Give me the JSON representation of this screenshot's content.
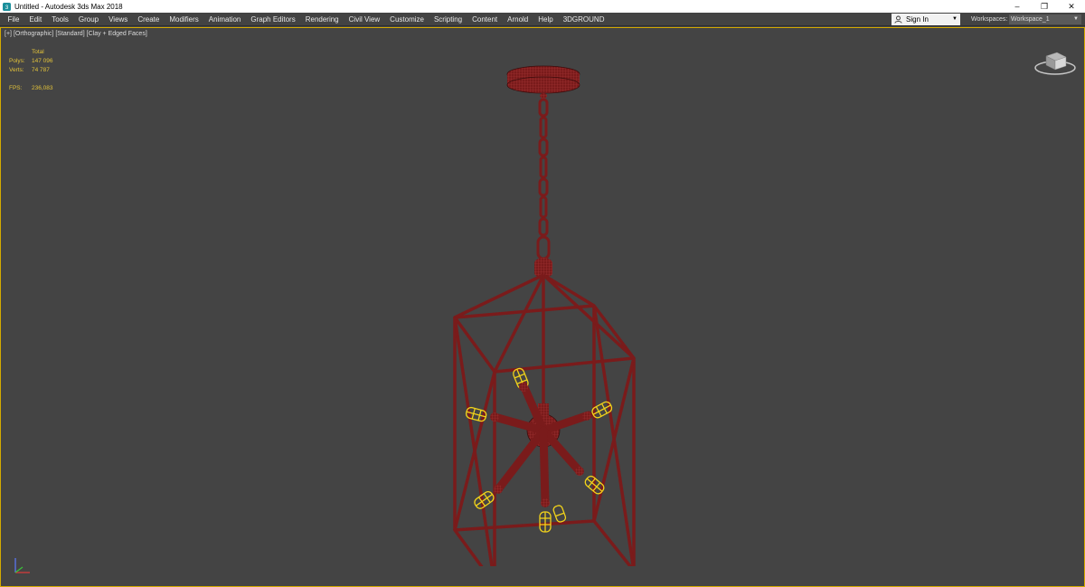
{
  "window": {
    "title": "Untitled - Autodesk 3ds Max 2018",
    "controls": {
      "minimize": "–",
      "restore": "❐",
      "close": "✕"
    }
  },
  "menubar": {
    "items": [
      "File",
      "Edit",
      "Tools",
      "Group",
      "Views",
      "Create",
      "Modifiers",
      "Animation",
      "Graph Editors",
      "Rendering",
      "Civil View",
      "Customize",
      "Scripting",
      "Content",
      "Arnold",
      "Help",
      "3DGROUND"
    ],
    "sign_in": "Sign In",
    "workspaces_label": "Workspaces:",
    "workspace_value": "Workspace_1"
  },
  "viewport": {
    "labels": [
      "[+]",
      "[Orthographic]",
      "[Standard]",
      "[Clay + Edged Faces]"
    ],
    "stats": {
      "header": "Total",
      "polys_label": "Polys:",
      "polys_value": "147 096",
      "verts_label": "Verts:",
      "verts_value": "74 787",
      "fps_label": "FPS:",
      "fps_value": "236,083"
    }
  },
  "icons": {
    "app": "3dsmax-app-icon",
    "user": "user-icon",
    "viewcube": "viewcube-icon",
    "axis": "axis-tripod-icon"
  },
  "colors": {
    "model_wire": "#8a1f1f",
    "selection": "#f2d31a",
    "viewport_border": "#d4aa00",
    "background": "#444444"
  }
}
